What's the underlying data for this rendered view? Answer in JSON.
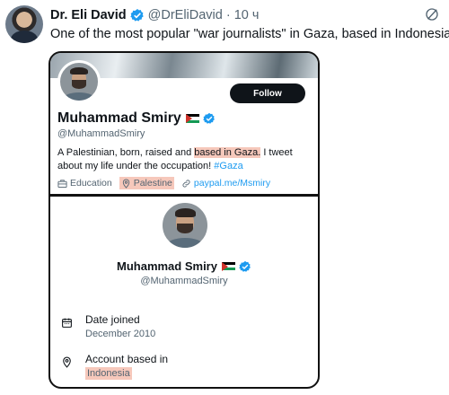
{
  "tweet": {
    "author_name": "Dr. Eli David",
    "author_handle": "@DrEliDavid",
    "separator": "·",
    "time": "10 ч",
    "text": "One of the most popular \"war journalists\" in Gaza, based in Indonesia",
    "emoji": "🤡",
    "accent_color": "#1d9bf0"
  },
  "screenshot_top": {
    "follow_label": "Follow",
    "name": "Muhammad Smiry",
    "handle": "@MuhammadSmiry",
    "bio_part1": "A Palestinian, born, raised and ",
    "bio_highlight": "based in Gaza.",
    "bio_part2": " I tweet about my life under the occupation! ",
    "bio_hashtag": "#Gaza",
    "meta": {
      "category": "Education",
      "location": "Palestine",
      "link": "paypal.me/Msmiry"
    },
    "highlight_color": "#f6c8bb"
  },
  "screenshot_bottom": {
    "name": "Muhammad Smiry",
    "handle": "@MuhammadSmiry",
    "date_joined_label": "Date joined",
    "date_joined_value": "December 2010",
    "account_based_label": "Account based in",
    "account_based_value": "Indonesia"
  }
}
